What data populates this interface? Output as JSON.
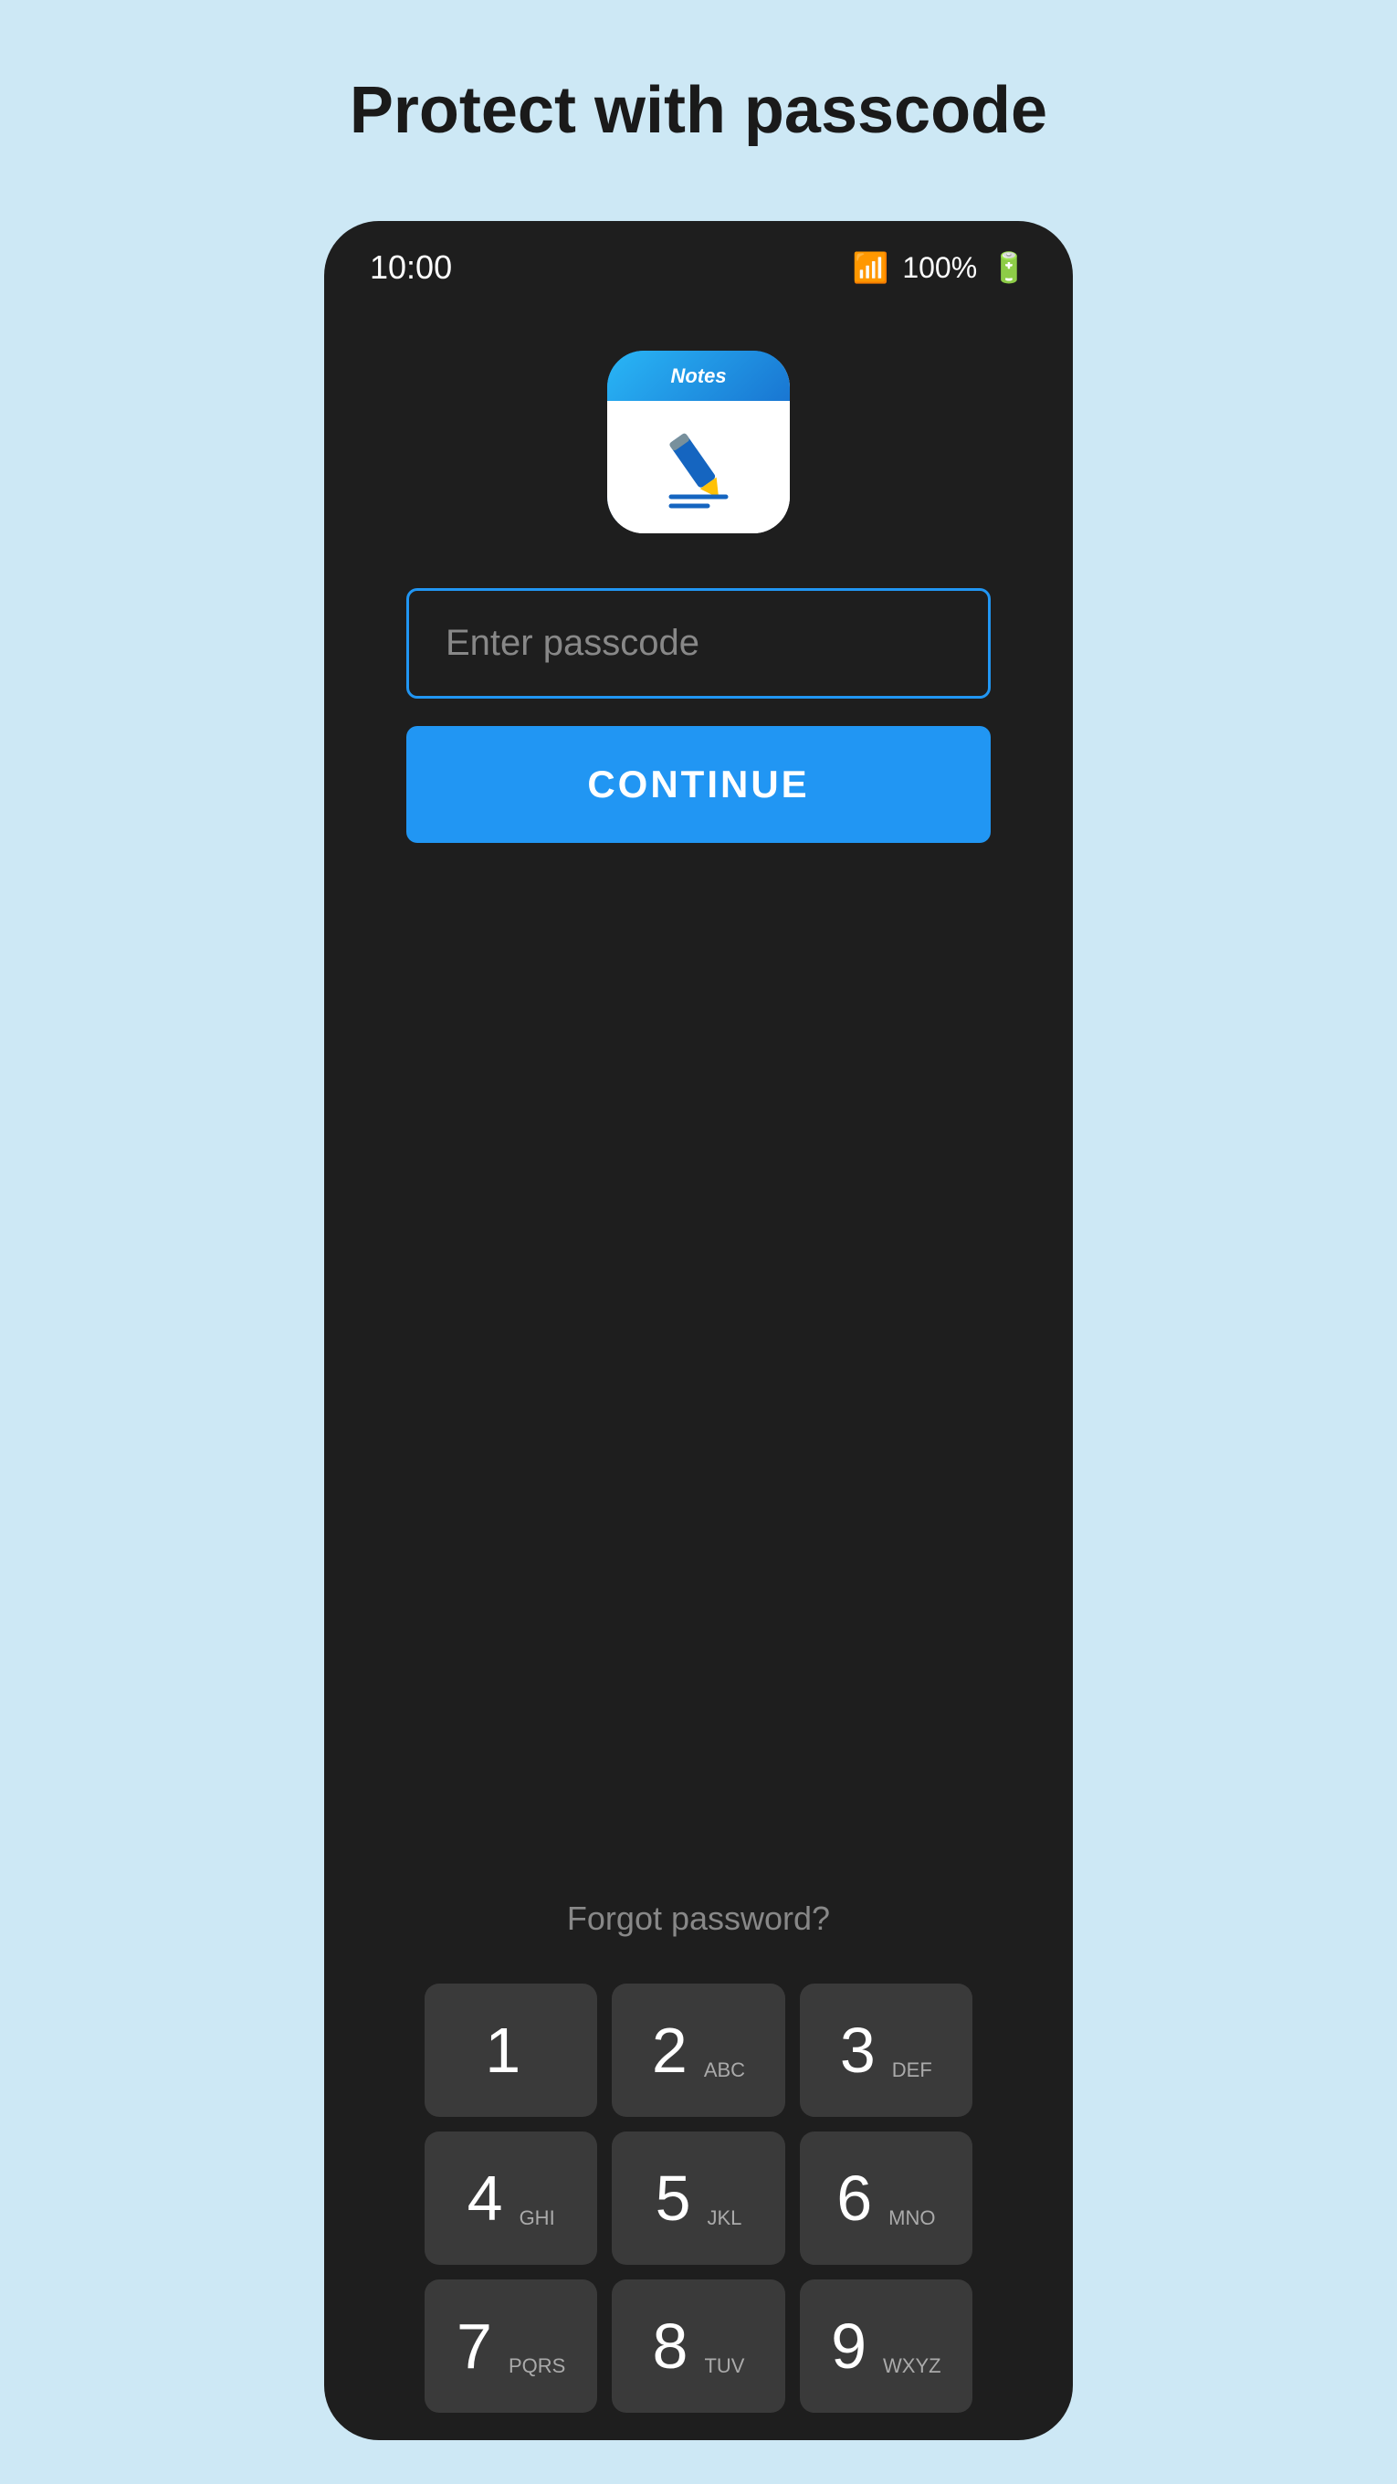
{
  "page": {
    "title": "Protect with passcode",
    "background_color": "#cde8f5"
  },
  "status_bar": {
    "time": "10:00",
    "battery_percent": "100%",
    "wifi_icon": "wifi",
    "battery_icon": "battery"
  },
  "app_icon": {
    "label": "Notes",
    "alt": "Notes app icon"
  },
  "passcode_input": {
    "placeholder": "Enter passcode",
    "value": ""
  },
  "continue_button": {
    "label": "CONTINUE"
  },
  "forgot_password": {
    "label": "Forgot password?"
  },
  "keypad": {
    "rows": [
      [
        {
          "number": "1",
          "letters": ""
        },
        {
          "number": "2",
          "letters": "ABC"
        },
        {
          "number": "3",
          "letters": "DEF"
        }
      ],
      [
        {
          "number": "4",
          "letters": "GHI"
        },
        {
          "number": "5",
          "letters": "JKL"
        },
        {
          "number": "6",
          "letters": "MNO"
        }
      ],
      [
        {
          "number": "7",
          "letters": "PQRS"
        },
        {
          "number": "8",
          "letters": "TUV"
        },
        {
          "number": "9",
          "letters": "WXYZ"
        }
      ]
    ]
  }
}
